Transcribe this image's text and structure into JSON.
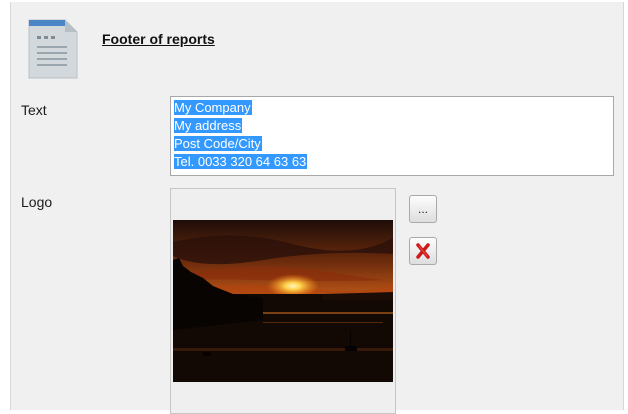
{
  "header": {
    "title": "Footer of reports",
    "icon": "document-icon"
  },
  "form": {
    "text_label": "Text",
    "text_lines": [
      "My Company",
      "My address",
      "Post Code/City",
      "Tel. 0033 320 64 63 63"
    ],
    "logo_label": "Logo",
    "browse_label": "...",
    "delete_icon": "red-x-icon"
  },
  "colors": {
    "selection": "#3399ff",
    "delete_red": "#cc1a1a",
    "panel_bg": "#f0f0f0"
  }
}
